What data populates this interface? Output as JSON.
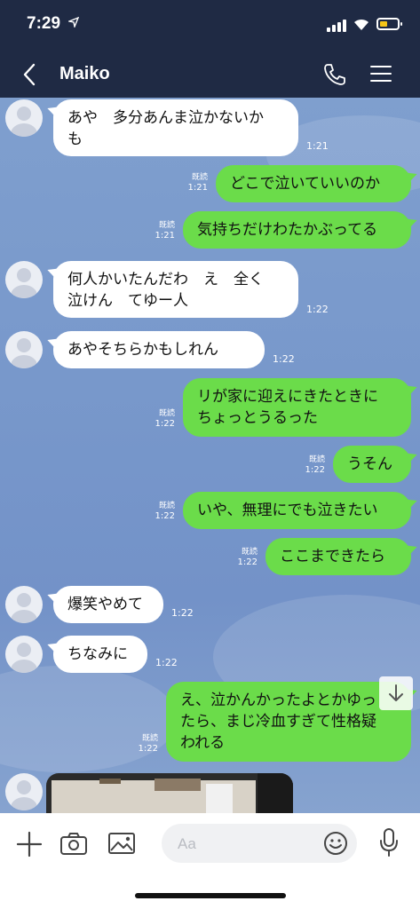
{
  "status_bar": {
    "time": "7:29",
    "location_arrow": "location-arrow-icon",
    "signal": "signal-icon",
    "wifi": "wifi-icon",
    "battery": "battery-icon"
  },
  "header": {
    "title": "Maiko",
    "back_icon": "chevron-left-icon",
    "call_icon": "phone-icon",
    "menu_icon": "menu-icon"
  },
  "colors": {
    "header_bg": "#1f2a44",
    "outgoing_bubble": "#6bdc4a",
    "incoming_bubble": "#ffffff",
    "chat_bg": "#7a9acc"
  },
  "messages": [
    {
      "direction": "in",
      "text": "あや　多分あんま泣かないか\nも",
      "time": "1:21"
    },
    {
      "direction": "out",
      "text": "どこで泣いていいのか",
      "read": "既読",
      "time": "1:21"
    },
    {
      "direction": "out",
      "text": "気持ちだけわたかぶってる",
      "read": "既読",
      "time": "1:21"
    },
    {
      "direction": "in",
      "text": "何人かいたんだわ　え　全く\n泣けん　てゆー人",
      "time": "1:22"
    },
    {
      "direction": "in",
      "text": "あやそちらかもしれん",
      "time": "1:22"
    },
    {
      "direction": "out",
      "text": "リが家に迎えにきたときに\nちょっとうるった",
      "read": "既読",
      "time": "1:22"
    },
    {
      "direction": "out",
      "text": "うそん",
      "read": "既読",
      "time": "1:22"
    },
    {
      "direction": "out",
      "text": "いや、無理にでも泣きたい",
      "read": "既読",
      "time": "1:22"
    },
    {
      "direction": "out",
      "text": "ここまできたら",
      "read": "既読",
      "time": "1:22"
    },
    {
      "direction": "in",
      "text": "爆笑やめて",
      "time": "1:22"
    },
    {
      "direction": "in",
      "text": "ちなみに",
      "time": "1:22"
    },
    {
      "direction": "out",
      "text": "え、泣かんかったよとかゆっ\nたら、まじ冷血すぎて性格疑\nわれる",
      "read": "既読",
      "time": "1:22"
    }
  ],
  "input_bar": {
    "placeholder": "Aa",
    "plus_icon": "plus-icon",
    "camera_icon": "camera-icon",
    "image_icon": "image-icon",
    "emoji_icon": "emoji-icon",
    "mic_icon": "microphone-icon"
  }
}
